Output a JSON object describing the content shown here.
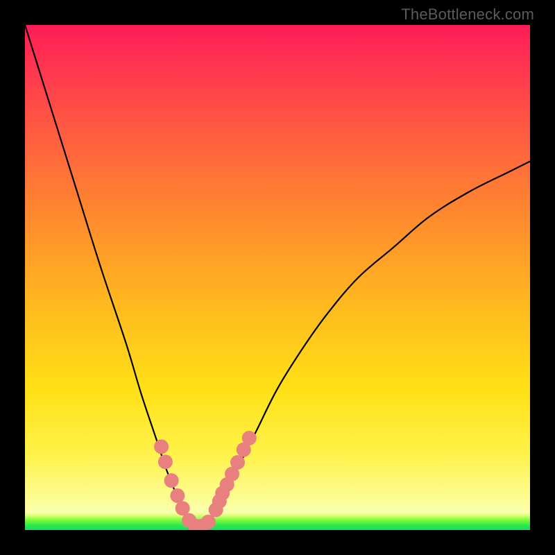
{
  "watermark": "TheBottleneck.com",
  "colors": {
    "background_frame": "#000000",
    "curve_stroke": "#000000",
    "marker_fill": "#e98080",
    "gradient_stops": [
      "#ff1b58",
      "#ff3550",
      "#ff5e40",
      "#ff8a2e",
      "#ffb81f",
      "#ffe016",
      "#fff24a",
      "#fdfd96",
      "#f9ffad",
      "#d6ff70",
      "#7dff3b",
      "#34e84a",
      "#0be05e"
    ]
  },
  "chart_data": {
    "type": "line",
    "title": "",
    "xlabel": "",
    "ylabel": "",
    "xlim": [
      0,
      100
    ],
    "ylim": [
      0,
      100
    ],
    "grid": false,
    "legend": false,
    "series": [
      {
        "name": "bottleneck-curve",
        "x": [
          0,
          5,
          10,
          15,
          20,
          23,
          26,
          28,
          30,
          32,
          33,
          34.5,
          36,
          38,
          40,
          43,
          46,
          50,
          55,
          60,
          66,
          73,
          80,
          88,
          96,
          100
        ],
        "y": [
          100,
          84,
          68,
          52,
          37,
          27,
          18,
          12,
          7,
          3,
          1.5,
          0.6,
          1.2,
          4,
          8,
          14,
          20,
          28,
          36,
          43,
          50,
          56,
          62,
          67,
          71,
          73
        ]
      }
    ],
    "markers": {
      "name": "highlight-points",
      "x": [
        27.0,
        27.8,
        29.0,
        30.2,
        31.2,
        32.5,
        33.7,
        35.0,
        36.3,
        37.8,
        38.5,
        39.1,
        40.0,
        41.0,
        42.1,
        43.3,
        44.4
      ],
      "y": [
        16.5,
        13.5,
        9.8,
        6.8,
        4.3,
        1.9,
        0.8,
        0.8,
        1.6,
        4.0,
        5.7,
        7.3,
        9.0,
        11.1,
        13.4,
        15.9,
        18.2
      ]
    },
    "annotations": []
  }
}
